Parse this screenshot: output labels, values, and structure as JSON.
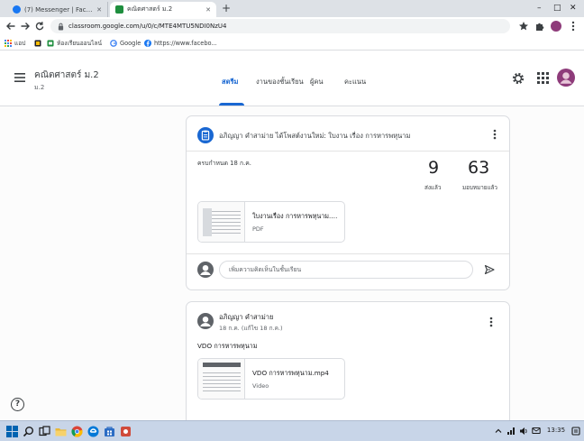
{
  "browser": {
    "tabs": [
      {
        "label": "(7) Messenger | Facebook",
        "favicon": "messenger-icon"
      },
      {
        "label": "คณิตศาสตร์ ม.2",
        "favicon": "classroom-icon"
      }
    ],
    "active_tab_index": 1,
    "url": "classroom.google.com/u/0/c/MTE4MTU5NDI0NzU4",
    "bookmarks": [
      {
        "label": "แอป",
        "icon": "apps-grid-icon"
      },
      {
        "label": "ห้องเรียนออนไลน์",
        "icon": "bookmark-icon"
      },
      {
        "label": "Google",
        "icon": "google-icon"
      },
      {
        "label": "https://www.facebo...",
        "icon": "facebook-icon"
      }
    ]
  },
  "classroom": {
    "class_name": "คณิตศาสตร์ ม.2",
    "section": "ม.2",
    "tabs": [
      {
        "label": "สตรีม",
        "active": true
      },
      {
        "label": "งานของชั้นเรียน",
        "active": false
      },
      {
        "label": "ผู้คน",
        "active": false
      },
      {
        "label": "คะแนน",
        "active": false
      }
    ]
  },
  "stream": {
    "posts": [
      {
        "type": "assignment",
        "icon": "assignment-icon",
        "header": "อภิญญา คำสาม่าย ได้โพสต์งานใหม่: ใบงาน เรื่อง การหารพหุนาม",
        "due": "ครบกำหนด 18 ก.ค.",
        "turned_in": {
          "value": "9",
          "label": "ส่งแล้ว"
        },
        "assigned": {
          "value": "63",
          "label": "มอบหมายแล้ว"
        },
        "attachment": {
          "title": "ใบงานเรื่อง การหารพหุนาม.pdf",
          "type": "PDF"
        },
        "comment_placeholder": "เพิ่มความคิดเห็นในชั้นเรียน"
      },
      {
        "type": "announcement",
        "author": "อภิญญา คำสาม่าย",
        "date": "18 ก.ค. (แก้ไข 18 ก.ค.)",
        "body": "VDO การหารพหุนาม",
        "attachment": {
          "title": "VDO การหารพหุนาม.mp4",
          "type": "Video"
        }
      }
    ]
  },
  "taskbar": {
    "time": "13:35",
    "pinned": [
      "windows-start-icon",
      "search-icon",
      "task-view-icon",
      "file-explorer-icon",
      "chrome-icon",
      "edge-icon",
      "store-icon",
      "app-icon"
    ]
  },
  "colors": {
    "accent": "#1967d2",
    "taskbar": "#c8d5e8"
  }
}
